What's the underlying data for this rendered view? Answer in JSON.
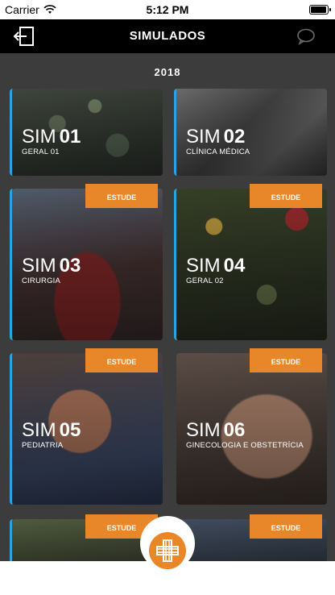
{
  "status_bar": {
    "carrier": "Carrier",
    "time": "5:12 PM",
    "battery_level": 0.95
  },
  "header": {
    "title": "SIMULADOS",
    "back_icon": "logout-icon",
    "chat_icon": "chat-icon"
  },
  "section": {
    "year": "2018"
  },
  "cards": [
    {
      "sim": "SIM",
      "number": "01",
      "subtitle": "GERAL 01",
      "cta": ""
    },
    {
      "sim": "SIM",
      "number": "02",
      "subtitle": "CLÍNICA MÉDICA",
      "cta": ""
    },
    {
      "sim": "SIM",
      "number": "03",
      "subtitle": "CIRURGIA",
      "cta": "ESTUDE"
    },
    {
      "sim": "SIM",
      "number": "04",
      "subtitle": "GERAL 02",
      "cta": "ESTUDE"
    },
    {
      "sim": "SIM",
      "number": "05",
      "subtitle": "PEDIATRIA",
      "cta": "ESTUDE"
    },
    {
      "sim": "SIM",
      "number": "06",
      "subtitle": "GINECOLOGIA E OBSTETRÍCIA",
      "cta": "ESTUDE"
    },
    {
      "cta": "ESTUDE"
    },
    {
      "cta": "ESTUDE"
    }
  ],
  "colors": {
    "accent": "#e8872a",
    "card_border": "#2aa4e0",
    "header_bg": "#000000",
    "content_bg": "#3c3c3c"
  },
  "bottom_nav": {
    "center_icon": "medical-cross-logo-icon"
  }
}
